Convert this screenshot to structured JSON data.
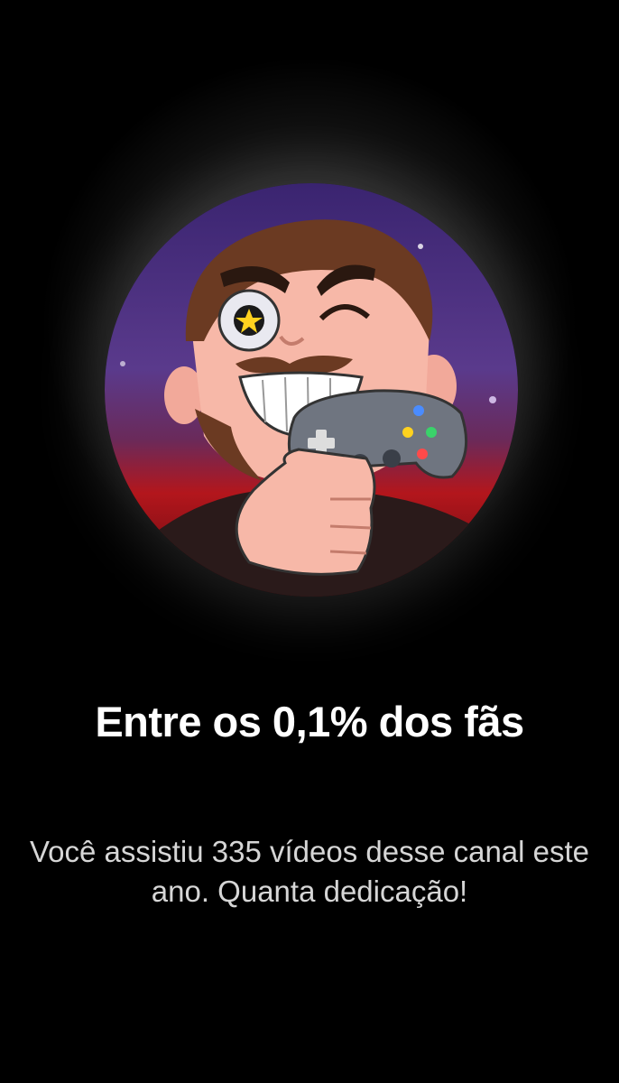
{
  "card": {
    "title": "Entre os 0,1% dos fãs",
    "description": "Você assistiu 335 vídeos desse canal este ano. Quanta dedicação!"
  },
  "avatar": {
    "icon": "channel-avatar-gamer",
    "colors": {
      "sky_purple": "#4b2a7a",
      "sky_red": "#b3161c",
      "skin": "#f7b8a8",
      "hair": "#6b3a22",
      "controller": "#6f7580"
    }
  }
}
